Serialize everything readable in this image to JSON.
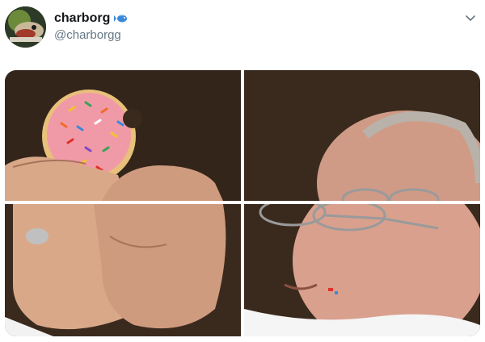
{
  "tweet": {
    "display_name": "charborg",
    "name_emoji": "fish-icon",
    "handle": "@charborgg"
  },
  "icons": {
    "menu": "chevron-down-icon"
  },
  "colors": {
    "handle": "#657786",
    "name": "#14171a",
    "fish": "#3b8ad9"
  }
}
